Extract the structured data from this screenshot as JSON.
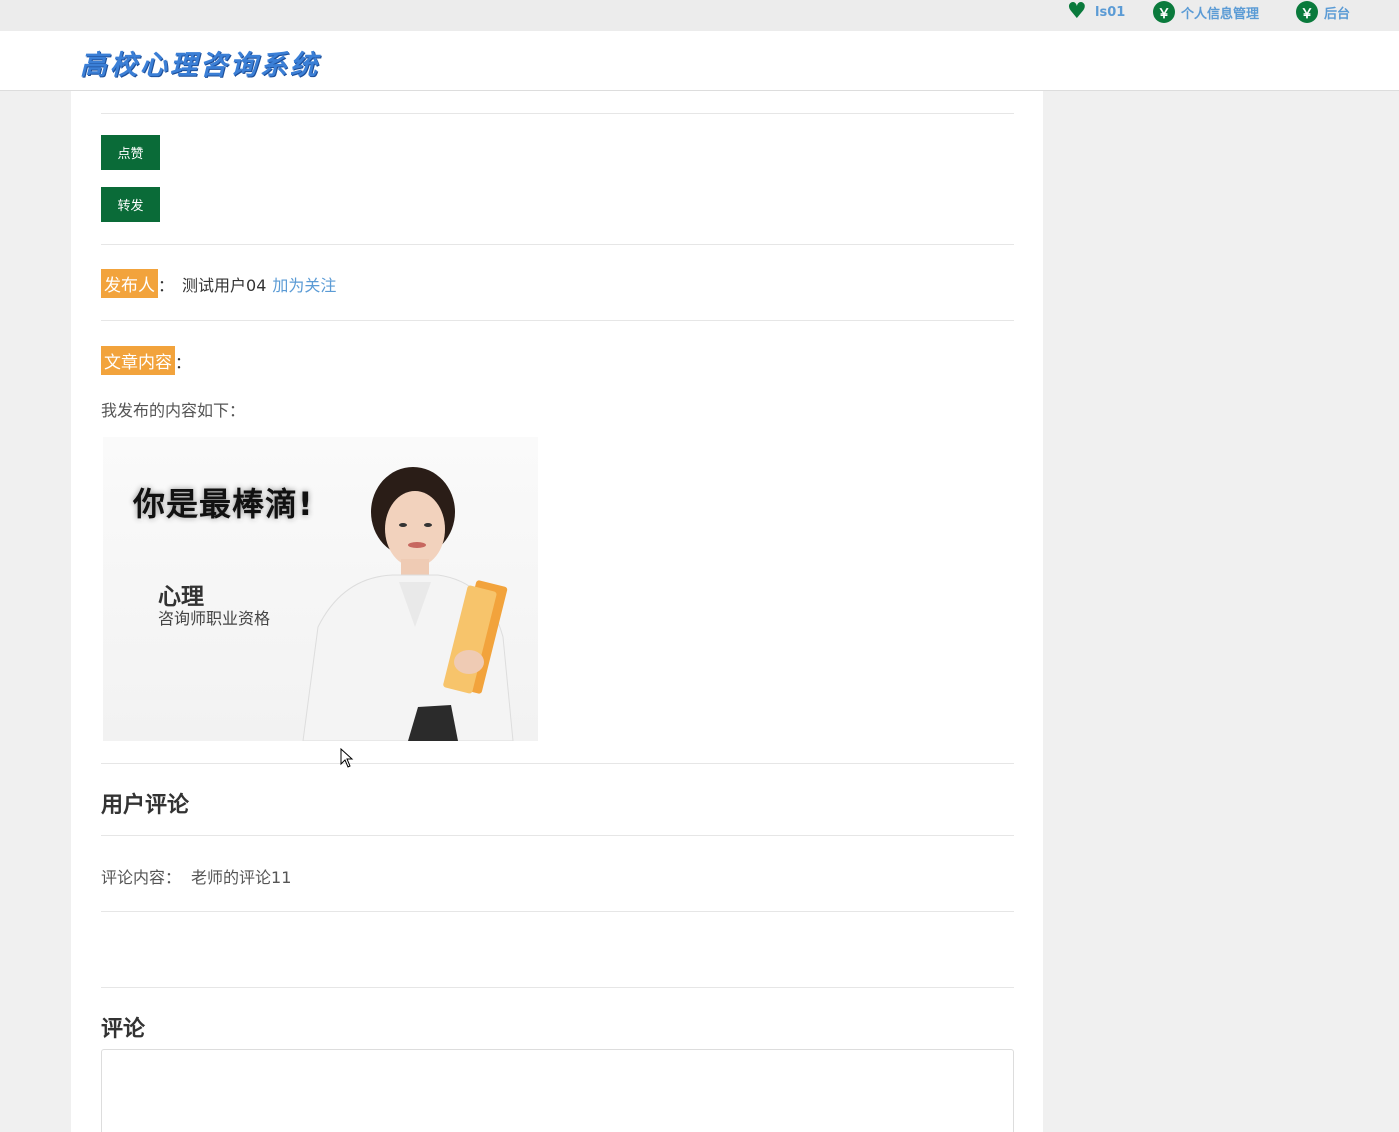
{
  "topbar": {
    "user": "ls01",
    "profile": "个人信息管理",
    "admin": "后台",
    "heart_icon": "heart-icon",
    "yen_icon_glyph": "￥"
  },
  "header": {
    "logo": "高校心理咨询系统"
  },
  "actions": {
    "like": "点赞",
    "forward": "转发"
  },
  "publisher": {
    "label": "发布人",
    "colon": "：",
    "name": "测试用户04",
    "follow": "加为关注"
  },
  "article": {
    "label": "文章内容",
    "colon": "：",
    "intro": "我发布的内容如下：",
    "poster_slogan": "你是最棒滴!",
    "poster_title": "心理",
    "poster_subtitle": "咨询师职业资格"
  },
  "comments": {
    "heading": "用户评论",
    "items": [
      {
        "label": "评论内容：",
        "text": "老师的评论11"
      }
    ]
  },
  "comment_form": {
    "heading": "评论"
  },
  "colors": {
    "brand_green": "#0a6b38",
    "tag_orange": "#f2a33c",
    "link_blue": "#5b9bd5"
  }
}
